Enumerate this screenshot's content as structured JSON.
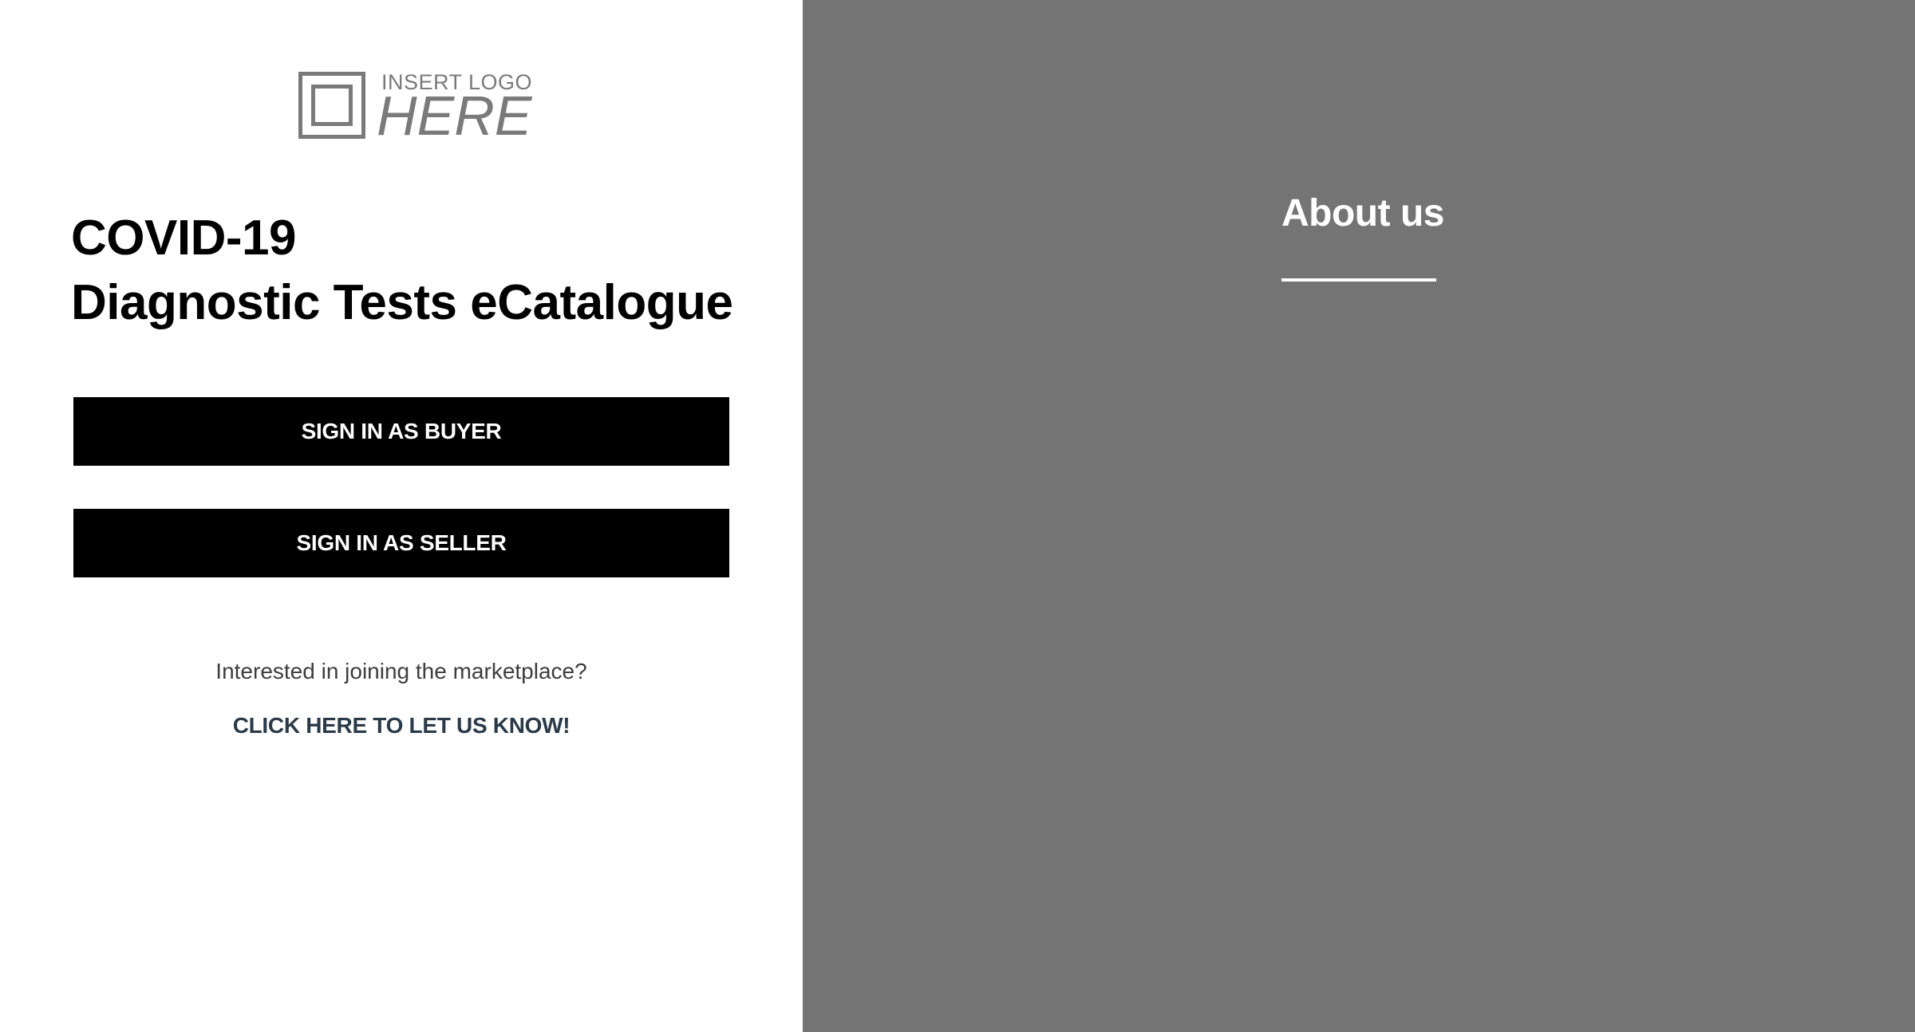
{
  "logo": {
    "line1": "INSERT LOGO",
    "line2": "HERE",
    "icon": "square-logo-icon"
  },
  "title": {
    "line1": "COVID-19",
    "line2": "Diagnostic Tests eCatalogue"
  },
  "buttons": {
    "buyer": "SIGN IN AS BUYER",
    "seller": "SIGN IN AS SELLER"
  },
  "join": {
    "question": "Interested in joining the marketplace?",
    "link": "CLICK HERE TO LET US KNOW!"
  },
  "about": {
    "heading": "About us"
  },
  "colors": {
    "button_bg": "#000000",
    "right_panel_bg": "#747474",
    "link_color": "#2a3a48",
    "logo_gray": "#7a7a7a"
  }
}
